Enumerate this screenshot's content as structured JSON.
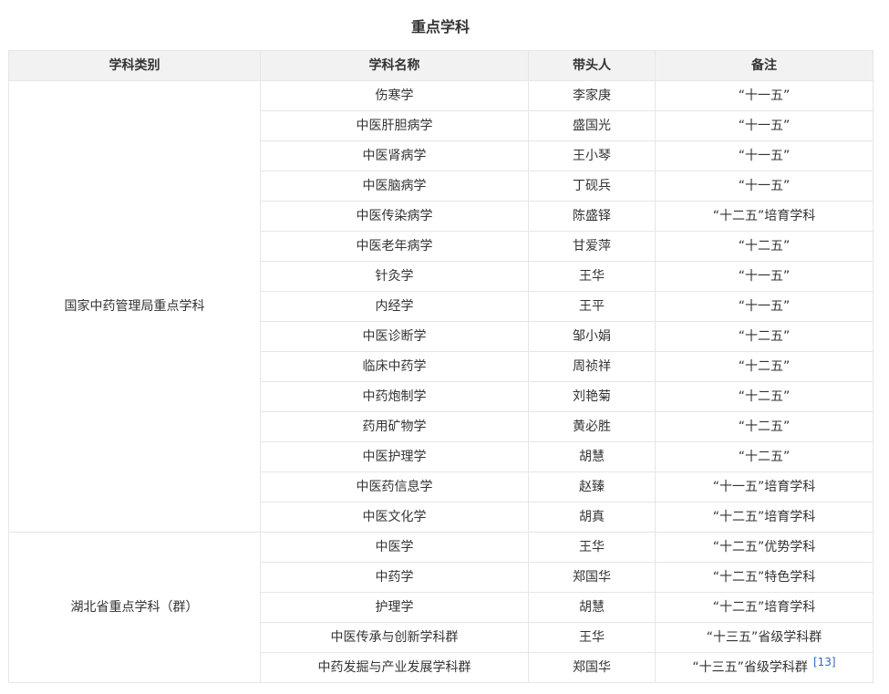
{
  "title": "重点学科",
  "headers": [
    "学科类别",
    "学科名称",
    "带头人",
    "备注"
  ],
  "groups": [
    {
      "category": "国家中药管理局重点学科",
      "rows": [
        {
          "name": "伤寒学",
          "leader": "李家庚",
          "note": "“十一五”"
        },
        {
          "name": "中医肝胆病学",
          "leader": "盛国光",
          "note": "“十一五”"
        },
        {
          "name": "中医肾病学",
          "leader": "王小琴",
          "note": "“十一五”"
        },
        {
          "name": "中医脑病学",
          "leader": "丁砚兵",
          "note": "“十一五”"
        },
        {
          "name": "中医传染病学",
          "leader": "陈盛铎",
          "note": "“十二五”培育学科"
        },
        {
          "name": "中医老年病学",
          "leader": "甘爱萍",
          "note": "“十二五”"
        },
        {
          "name": "针灸学",
          "leader": "王华",
          "note": "“十一五”"
        },
        {
          "name": "内经学",
          "leader": "王平",
          "note": "“十一五”"
        },
        {
          "name": "中医诊断学",
          "leader": "邹小娟",
          "note": "“十二五”"
        },
        {
          "name": "临床中药学",
          "leader": "周祯祥",
          "note": "“十二五”"
        },
        {
          "name": "中药炮制学",
          "leader": "刘艳菊",
          "note": "“十二五”"
        },
        {
          "name": "药用矿物学",
          "leader": "黄必胜",
          "note": "“十二五”"
        },
        {
          "name": "中医护理学",
          "leader": "胡慧",
          "note": "“十二五”"
        },
        {
          "name": "中医药信息学",
          "leader": "赵臻",
          "note": "“十一五”培育学科"
        },
        {
          "name": "中医文化学",
          "leader": "胡真",
          "note": "“十二五”培育学科"
        }
      ]
    },
    {
      "category": "湖北省重点学科（群）",
      "rows": [
        {
          "name": "中医学",
          "leader": "王华",
          "note": "“十二五”优势学科"
        },
        {
          "name": "中药学",
          "leader": "郑国华",
          "note": "“十二五”特色学科"
        },
        {
          "name": "护理学",
          "leader": "胡慧",
          "note": "“十二五”培育学科"
        },
        {
          "name": "中医传承与创新学科群",
          "leader": "王华",
          "note": "“十三五”省级学科群"
        },
        {
          "name": "中药发掘与产业发展学科群",
          "leader": "郑国华",
          "note": "“十三五”省级学科群",
          "ref": "[13]"
        }
      ]
    }
  ]
}
